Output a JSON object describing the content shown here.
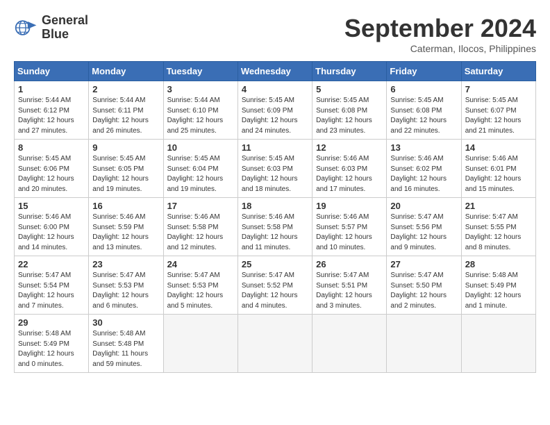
{
  "logo": {
    "line1": "General",
    "line2": "Blue"
  },
  "title": "September 2024",
  "location": "Caterman, Ilocos, Philippines",
  "weekdays": [
    "Sunday",
    "Monday",
    "Tuesday",
    "Wednesday",
    "Thursday",
    "Friday",
    "Saturday"
  ],
  "weeks": [
    [
      {
        "day": "1",
        "info": "Sunrise: 5:44 AM\nSunset: 6:12 PM\nDaylight: 12 hours\nand 27 minutes."
      },
      {
        "day": "2",
        "info": "Sunrise: 5:44 AM\nSunset: 6:11 PM\nDaylight: 12 hours\nand 26 minutes."
      },
      {
        "day": "3",
        "info": "Sunrise: 5:44 AM\nSunset: 6:10 PM\nDaylight: 12 hours\nand 25 minutes."
      },
      {
        "day": "4",
        "info": "Sunrise: 5:45 AM\nSunset: 6:09 PM\nDaylight: 12 hours\nand 24 minutes."
      },
      {
        "day": "5",
        "info": "Sunrise: 5:45 AM\nSunset: 6:08 PM\nDaylight: 12 hours\nand 23 minutes."
      },
      {
        "day": "6",
        "info": "Sunrise: 5:45 AM\nSunset: 6:08 PM\nDaylight: 12 hours\nand 22 minutes."
      },
      {
        "day": "7",
        "info": "Sunrise: 5:45 AM\nSunset: 6:07 PM\nDaylight: 12 hours\nand 21 minutes."
      }
    ],
    [
      {
        "day": "8",
        "info": "Sunrise: 5:45 AM\nSunset: 6:06 PM\nDaylight: 12 hours\nand 20 minutes."
      },
      {
        "day": "9",
        "info": "Sunrise: 5:45 AM\nSunset: 6:05 PM\nDaylight: 12 hours\nand 19 minutes."
      },
      {
        "day": "10",
        "info": "Sunrise: 5:45 AM\nSunset: 6:04 PM\nDaylight: 12 hours\nand 19 minutes."
      },
      {
        "day": "11",
        "info": "Sunrise: 5:45 AM\nSunset: 6:03 PM\nDaylight: 12 hours\nand 18 minutes."
      },
      {
        "day": "12",
        "info": "Sunrise: 5:46 AM\nSunset: 6:03 PM\nDaylight: 12 hours\nand 17 minutes."
      },
      {
        "day": "13",
        "info": "Sunrise: 5:46 AM\nSunset: 6:02 PM\nDaylight: 12 hours\nand 16 minutes."
      },
      {
        "day": "14",
        "info": "Sunrise: 5:46 AM\nSunset: 6:01 PM\nDaylight: 12 hours\nand 15 minutes."
      }
    ],
    [
      {
        "day": "15",
        "info": "Sunrise: 5:46 AM\nSunset: 6:00 PM\nDaylight: 12 hours\nand 14 minutes."
      },
      {
        "day": "16",
        "info": "Sunrise: 5:46 AM\nSunset: 5:59 PM\nDaylight: 12 hours\nand 13 minutes."
      },
      {
        "day": "17",
        "info": "Sunrise: 5:46 AM\nSunset: 5:58 PM\nDaylight: 12 hours\nand 12 minutes."
      },
      {
        "day": "18",
        "info": "Sunrise: 5:46 AM\nSunset: 5:58 PM\nDaylight: 12 hours\nand 11 minutes."
      },
      {
        "day": "19",
        "info": "Sunrise: 5:46 AM\nSunset: 5:57 PM\nDaylight: 12 hours\nand 10 minutes."
      },
      {
        "day": "20",
        "info": "Sunrise: 5:47 AM\nSunset: 5:56 PM\nDaylight: 12 hours\nand 9 minutes."
      },
      {
        "day": "21",
        "info": "Sunrise: 5:47 AM\nSunset: 5:55 PM\nDaylight: 12 hours\nand 8 minutes."
      }
    ],
    [
      {
        "day": "22",
        "info": "Sunrise: 5:47 AM\nSunset: 5:54 PM\nDaylight: 12 hours\nand 7 minutes."
      },
      {
        "day": "23",
        "info": "Sunrise: 5:47 AM\nSunset: 5:53 PM\nDaylight: 12 hours\nand 6 minutes."
      },
      {
        "day": "24",
        "info": "Sunrise: 5:47 AM\nSunset: 5:53 PM\nDaylight: 12 hours\nand 5 minutes."
      },
      {
        "day": "25",
        "info": "Sunrise: 5:47 AM\nSunset: 5:52 PM\nDaylight: 12 hours\nand 4 minutes."
      },
      {
        "day": "26",
        "info": "Sunrise: 5:47 AM\nSunset: 5:51 PM\nDaylight: 12 hours\nand 3 minutes."
      },
      {
        "day": "27",
        "info": "Sunrise: 5:47 AM\nSunset: 5:50 PM\nDaylight: 12 hours\nand 2 minutes."
      },
      {
        "day": "28",
        "info": "Sunrise: 5:48 AM\nSunset: 5:49 PM\nDaylight: 12 hours\nand 1 minute."
      }
    ],
    [
      {
        "day": "29",
        "info": "Sunrise: 5:48 AM\nSunset: 5:49 PM\nDaylight: 12 hours\nand 0 minutes."
      },
      {
        "day": "30",
        "info": "Sunrise: 5:48 AM\nSunset: 5:48 PM\nDaylight: 11 hours\nand 59 minutes."
      },
      {
        "day": "",
        "info": ""
      },
      {
        "day": "",
        "info": ""
      },
      {
        "day": "",
        "info": ""
      },
      {
        "day": "",
        "info": ""
      },
      {
        "day": "",
        "info": ""
      }
    ]
  ]
}
